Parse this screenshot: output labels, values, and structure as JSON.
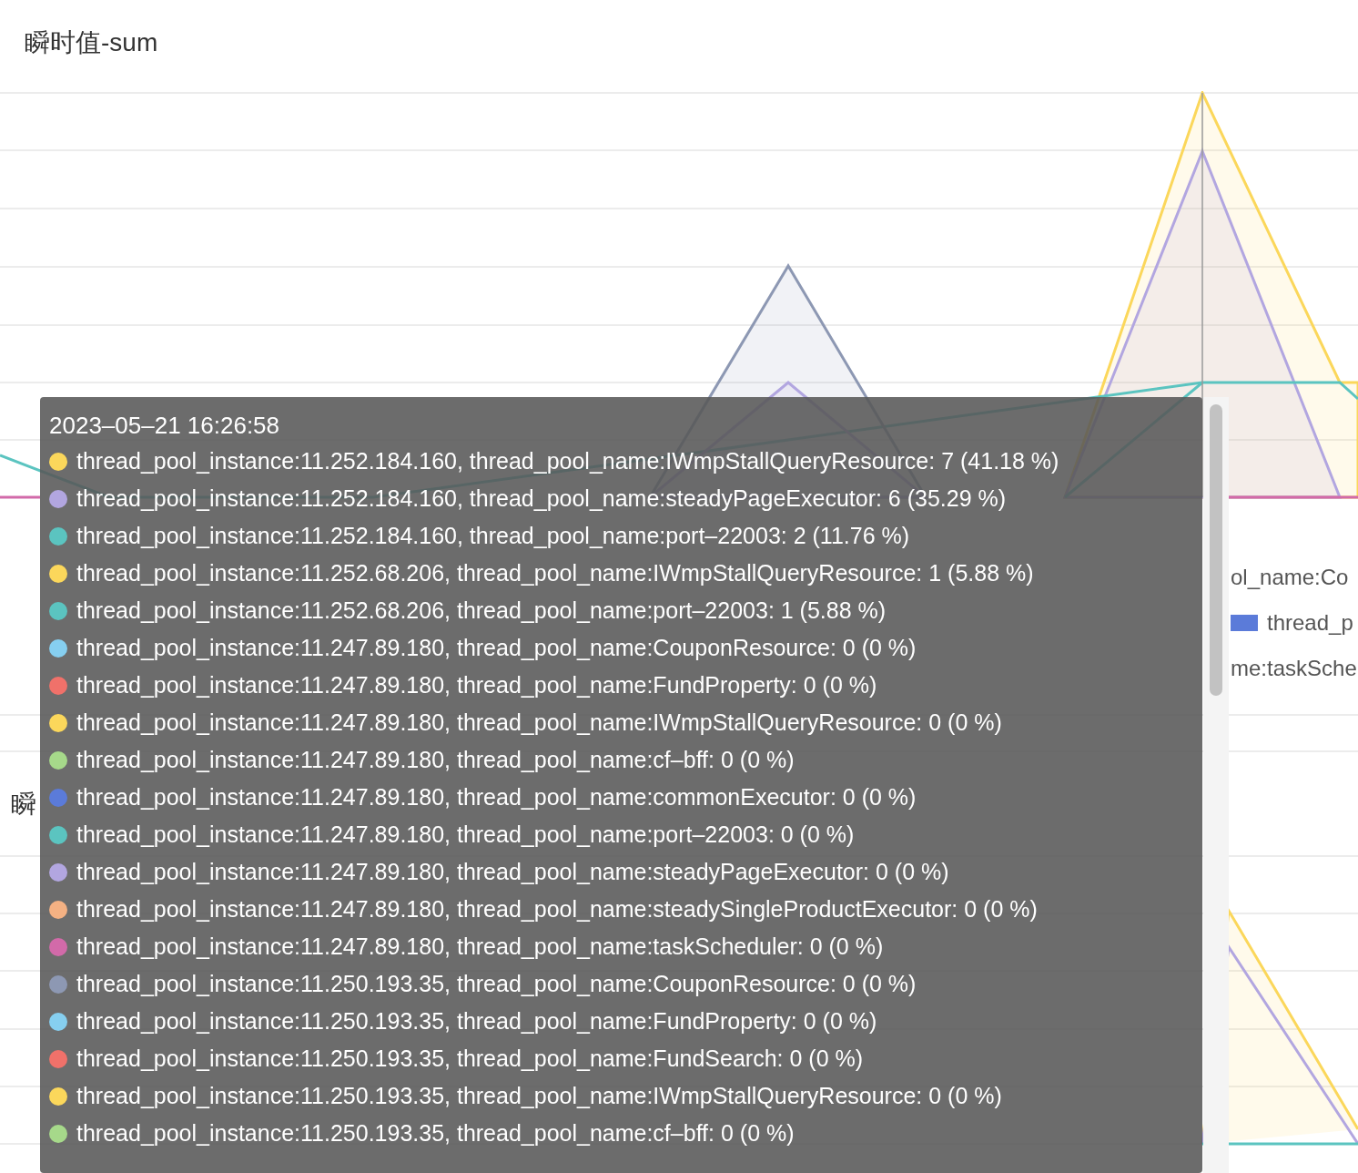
{
  "title": "瞬时值-sum",
  "legend": [
    {
      "text": "ol_name:Co"
    },
    {
      "text": "thread_p",
      "color": "#5b7bd9"
    },
    {
      "text": "me:taskSche"
    }
  ],
  "second_title": "瞬",
  "tooltip": {
    "time": "2023–05–21 16:26:58",
    "items": [
      {
        "text": "thread_pool_instance:11.252.184.160, thread_pool_name:IWmpStallQueryResource: 7 (41.18 %)",
        "color": "#fbd75b"
      },
      {
        "text": "thread_pool_instance:11.252.184.160, thread_pool_name:steadyPageExecutor: 6 (35.29 %)",
        "color": "#b2a6e0"
      },
      {
        "text": "thread_pool_instance:11.252.184.160, thread_pool_name:port–22003: 2 (11.76 %)",
        "color": "#5bc4c0"
      },
      {
        "text": "thread_pool_instance:11.252.68.206, thread_pool_name:IWmpStallQueryResource: 1 (5.88 %)",
        "color": "#fbd75b"
      },
      {
        "text": "thread_pool_instance:11.252.68.206, thread_pool_name:port–22003: 1 (5.88 %)",
        "color": "#5bc4c0"
      },
      {
        "text": "thread_pool_instance:11.247.89.180, thread_pool_name:CouponResource: 0 (0 %)",
        "color": "#86cff0"
      },
      {
        "text": "thread_pool_instance:11.247.89.180, thread_pool_name:FundProperty: 0 (0 %)",
        "color": "#f0716a"
      },
      {
        "text": "thread_pool_instance:11.247.89.180, thread_pool_name:IWmpStallQueryResource: 0 (0 %)",
        "color": "#fbd75b"
      },
      {
        "text": "thread_pool_instance:11.247.89.180, thread_pool_name:cf–bff: 0 (0 %)",
        "color": "#a6d98a"
      },
      {
        "text": "thread_pool_instance:11.247.89.180, thread_pool_name:commonExecutor: 0 (0 %)",
        "color": "#5b7bd9"
      },
      {
        "text": "thread_pool_instance:11.247.89.180, thread_pool_name:port–22003: 0 (0 %)",
        "color": "#5bc4c0"
      },
      {
        "text": "thread_pool_instance:11.247.89.180, thread_pool_name:steadyPageExecutor: 0 (0 %)",
        "color": "#b2a6e0"
      },
      {
        "text": "thread_pool_instance:11.247.89.180, thread_pool_name:steadySingleProductExecutor: 0 (0 %)",
        "color": "#f4b183"
      },
      {
        "text": "thread_pool_instance:11.247.89.180, thread_pool_name:taskScheduler: 0 (0 %)",
        "color": "#d26aa9"
      },
      {
        "text": "thread_pool_instance:11.250.193.35, thread_pool_name:CouponResource: 0 (0 %)",
        "color": "#8d98b3"
      },
      {
        "text": "thread_pool_instance:11.250.193.35, thread_pool_name:FundProperty: 0 (0 %)",
        "color": "#86cff0"
      },
      {
        "text": "thread_pool_instance:11.250.193.35, thread_pool_name:FundSearch: 0 (0 %)",
        "color": "#f0716a"
      },
      {
        "text": "thread_pool_instance:11.250.193.35, thread_pool_name:IWmpStallQueryResource: 0 (0 %)",
        "color": "#fbd75b"
      },
      {
        "text": "thread_pool_instance:11.250.193.35, thread_pool_name:cf–bff: 0 (0 %)",
        "color": "#a6d98a"
      }
    ]
  }
}
